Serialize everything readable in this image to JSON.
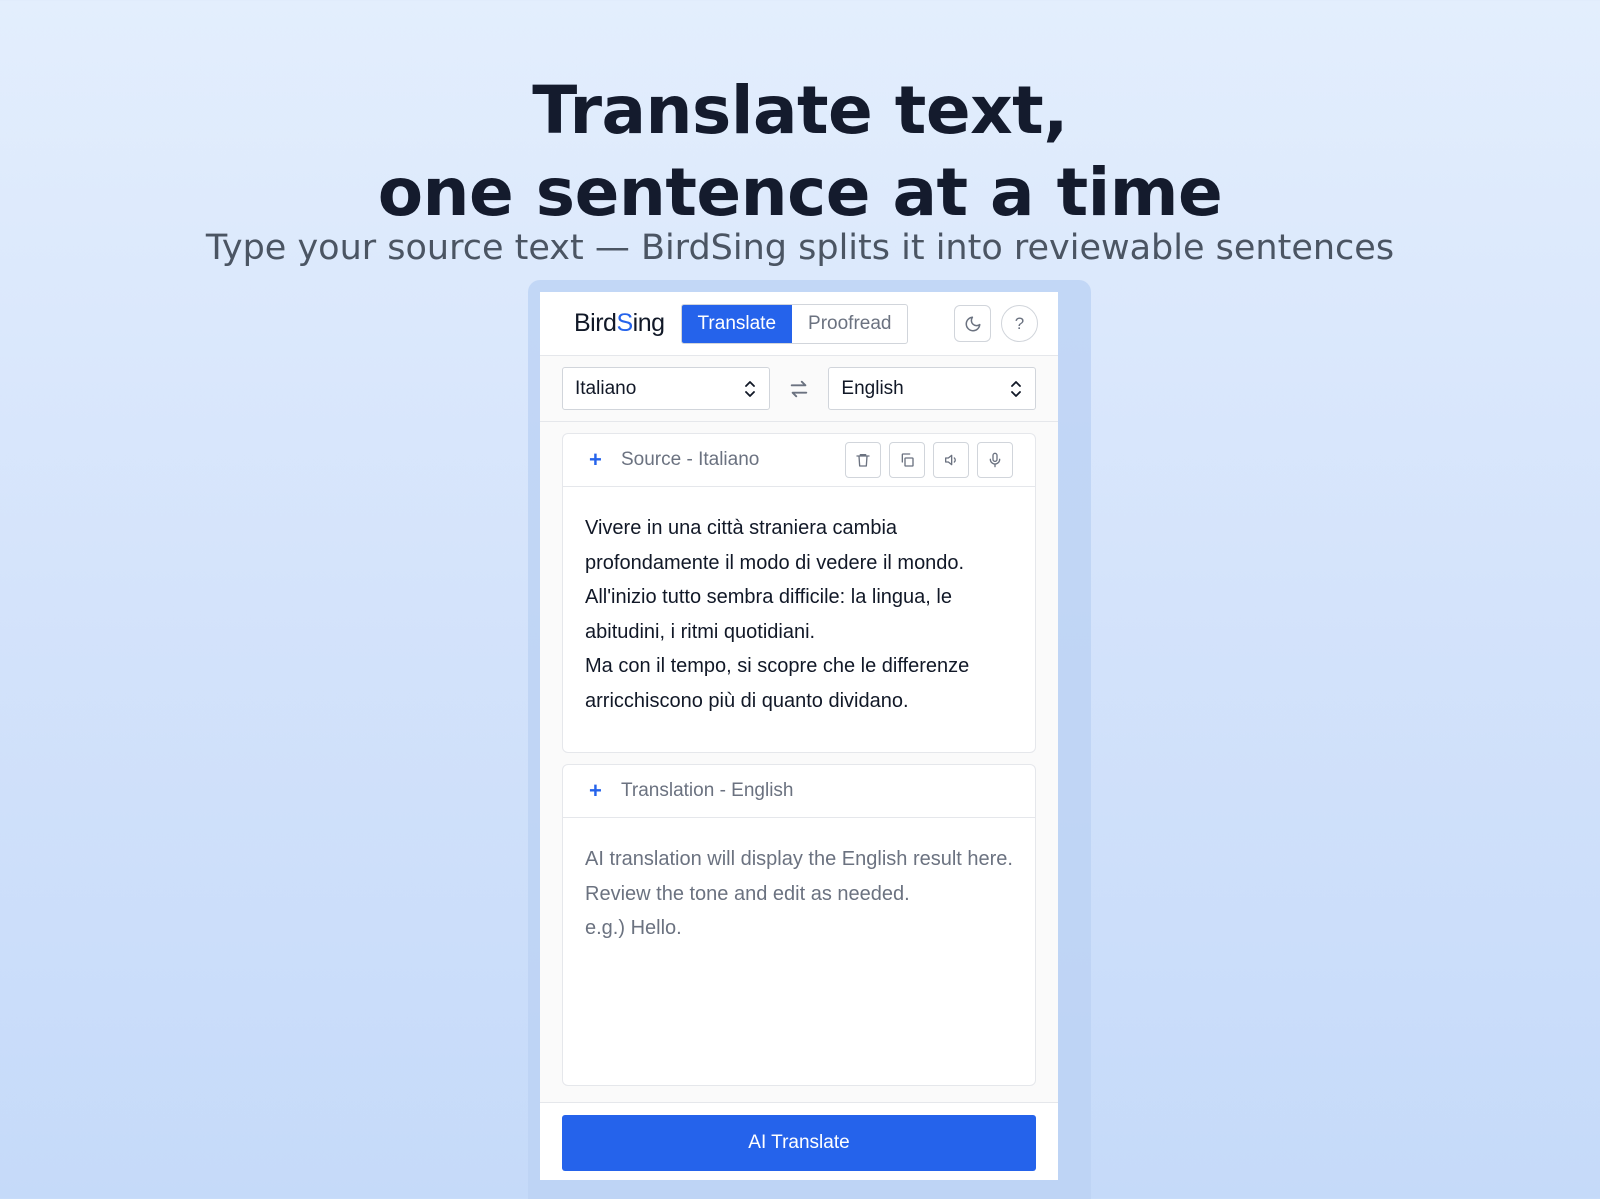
{
  "hero": {
    "title_line1": "Translate text,",
    "title_line2": "one sentence at a time",
    "subtitle": "Type your source text — BirdSing splits it into reviewable sentences"
  },
  "app": {
    "logo_part1": "Bird",
    "logo_part2": "S",
    "logo_part3": "ing",
    "tabs": [
      {
        "label": "Translate",
        "active": true
      },
      {
        "label": "Proofread",
        "active": false
      }
    ],
    "theme_icon": "moon-icon",
    "help_label": "?",
    "source_language": "Italiano",
    "target_language": "English",
    "source_panel": {
      "title": "Source - Italiano",
      "tools": [
        "trash-icon",
        "copy-icon",
        "speaker-icon",
        "microphone-icon"
      ],
      "lines": [
        "Vivere in una città straniera cambia profondamente il modo di vedere il mondo.",
        "All'inizio tutto sembra difficile: la lingua, le abitudini, i ritmi quotidiani.",
        "Ma con il tempo, si scopre che le differenze arricchiscono più di quanto dividano."
      ]
    },
    "translation_panel": {
      "title": "Translation - English",
      "placeholder_lines": [
        "AI translation will display the English result here.",
        "Review the tone and edit as needed.",
        "e.g.) Hello."
      ]
    },
    "cta_label": "AI Translate",
    "accent_color": "#2563eb"
  }
}
